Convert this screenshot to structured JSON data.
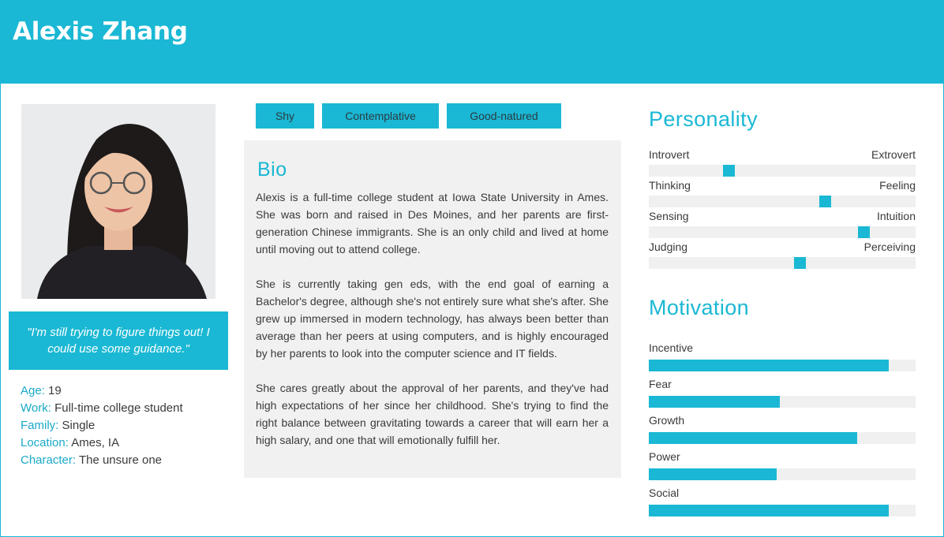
{
  "persona": {
    "name": "Alexis Zhang",
    "quote": "\"I'm still trying to figure things out! I could use some guidance.\"",
    "facts": [
      {
        "key": "Age:",
        "value": "19"
      },
      {
        "key": "Work:",
        "value": "Full-time college student"
      },
      {
        "key": "Family:",
        "value": "Single"
      },
      {
        "key": "Location:",
        "value": "Ames, IA"
      },
      {
        "key": "Character:",
        "value": "The unsure one"
      }
    ],
    "tags": [
      "Shy",
      "Contemplative",
      "Good-natured"
    ]
  },
  "bio": {
    "title": "Bio",
    "paragraphs": [
      "Alexis is a full-time college student at Iowa State University in Ames. She was born and raised in Des Moines, and her parents are first-generation Chinese immigrants. She is an only child and lived at home until moving out to attend college.",
      "She is currently taking gen eds, with the end goal of earning a Bachelor's degree, although she's not entirely sure what she's after. She grew up immersed in modern technology, has always been better than average than her peers at using computers, and is highly encouraged by her parents to look into the computer science and IT fields.",
      "She cares greatly about the approval of her parents, and they've had high expectations of her since her childhood. She's trying to find the right balance between gravitating towards a career that will earn her a high salary, and one that will emotionally fulfill her."
    ]
  },
  "personality": {
    "title": "Personality",
    "traits": [
      {
        "left": "Introvert",
        "right": "Extrovert",
        "value": 0.29
      },
      {
        "left": "Thinking",
        "right": "Feeling",
        "value": 0.67
      },
      {
        "left": "Sensing",
        "right": "Intuition",
        "value": 0.82
      },
      {
        "left": "Judging",
        "right": "Perceiving",
        "value": 0.57
      }
    ]
  },
  "motivation": {
    "title": "Motivation",
    "items": [
      {
        "label": "Incentive",
        "value": 0.9
      },
      {
        "label": "Fear",
        "value": 0.49
      },
      {
        "label": "Growth",
        "value": 0.78
      },
      {
        "label": "Power",
        "value": 0.48
      },
      {
        "label": "Social",
        "value": 0.9
      }
    ]
  },
  "colors": {
    "accent": "#1ab8d4",
    "track": "#f0f0f0",
    "panel": "#f1f1f1"
  }
}
